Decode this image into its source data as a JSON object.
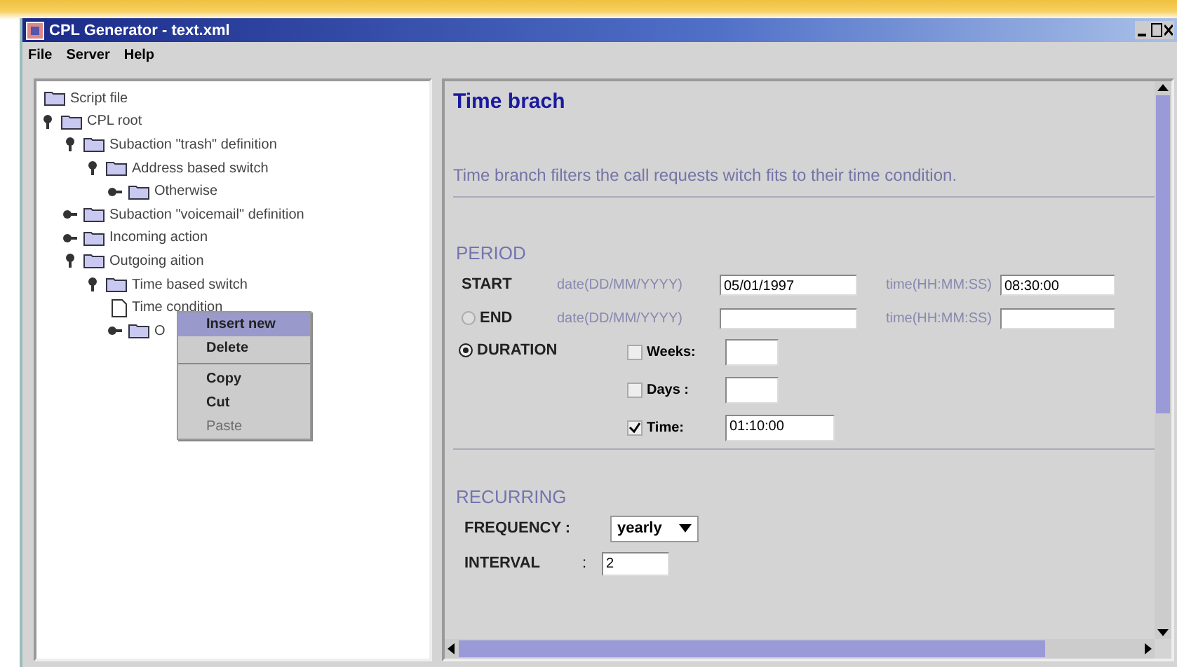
{
  "window": {
    "title": "CPL Generator - text.xml"
  },
  "menu": [
    "File",
    "Server",
    "Help"
  ],
  "tree": [
    {
      "label": "Script file",
      "kind": "folder"
    },
    {
      "label": "CPL root",
      "kind": "folder",
      "expanded": true,
      "children": [
        {
          "label": "Subaction \"trash\" definition",
          "kind": "folder",
          "expanded": true,
          "children": [
            {
              "label": "Address based switch",
              "kind": "folder",
              "expanded": true,
              "children": [
                {
                  "label": "Otherwise",
                  "kind": "folder",
                  "expanded": false
                }
              ]
            }
          ]
        },
        {
          "label": "Subaction \"voicemail\" definition",
          "kind": "folder",
          "expanded": false
        },
        {
          "label": "Incoming action",
          "kind": "folder",
          "expanded": false
        },
        {
          "label": "Outgoing aition",
          "kind": "folder",
          "expanded": true,
          "children": [
            {
              "label": "Time based switch",
              "kind": "folder",
              "expanded": true,
              "children": [
                {
                  "label": "Time condition",
                  "kind": "file"
                },
                {
                  "label": "O",
                  "kind": "folder",
                  "expanded": false
                }
              ]
            }
          ]
        }
      ]
    }
  ],
  "context_menu": [
    {
      "kind": "item",
      "label": "Insert new",
      "selected": true,
      "disabled": false
    },
    {
      "kind": "item",
      "label": "Delete",
      "selected": false,
      "disabled": false
    },
    {
      "kind": "separator"
    },
    {
      "kind": "item",
      "label": "Copy",
      "selected": false,
      "disabled": false
    },
    {
      "kind": "item",
      "label": "Cut",
      "selected": false,
      "disabled": false
    },
    {
      "kind": "item",
      "label": "Paste",
      "selected": false,
      "disabled": true
    }
  ],
  "form": {
    "title": "Time brach",
    "description": "Time branch filters the call requests witch fits to their time condition.",
    "period": {
      "heading": "PERIOD",
      "start": {
        "label": "START",
        "date_label": "date(DD/MM/YYYY)",
        "date_value": "05/01/1997",
        "time_label": "time(HH:MM:SS)",
        "time_value": "08:30:00"
      },
      "end": {
        "label": "END",
        "selected": false,
        "date_label": "date(DD/MM/YYYY)",
        "time_label": "time(HH:MM:SS)"
      },
      "duration": {
        "label": "DURATION",
        "selected": true,
        "options": [
          {
            "label": "Weeks:",
            "checked": false
          },
          {
            "label": "Days :",
            "checked": false
          },
          {
            "label": "Time:",
            "checked": true,
            "value": "01:10:00"
          }
        ]
      }
    },
    "recurring": {
      "heading": "RECURRING",
      "frequency_label": "FREQUENCY :",
      "frequency_value": "yearly",
      "interval_label": "INTERVAL",
      "interval_sep": ":",
      "interval_value": "2"
    }
  }
}
